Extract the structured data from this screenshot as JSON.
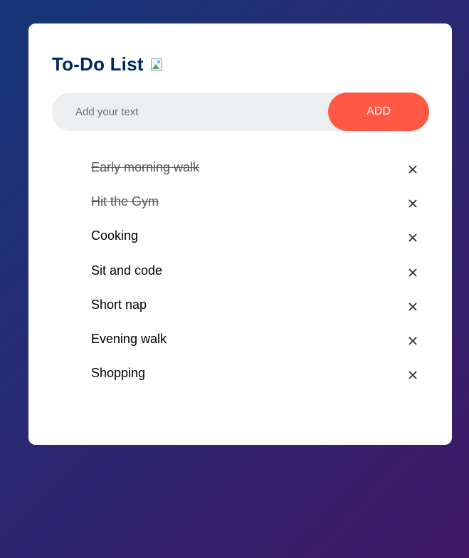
{
  "app": {
    "title": "To-Do List"
  },
  "input": {
    "placeholder": "Add your text",
    "value": ""
  },
  "add_button": {
    "label": "ADD"
  },
  "tasks": [
    {
      "label": "Early morning walk",
      "checked": true
    },
    {
      "label": "Hit the Gym",
      "checked": true
    },
    {
      "label": "Cooking",
      "checked": false
    },
    {
      "label": "Sit and code",
      "checked": false
    },
    {
      "label": "Short nap",
      "checked": false
    },
    {
      "label": "Evening walk",
      "checked": false
    },
    {
      "label": "Shopping",
      "checked": false
    }
  ],
  "icons": {
    "title_icon": "broken-image-icon",
    "remove_icon": "close-icon"
  },
  "colors": {
    "accent": "#ff5945",
    "title": "#002765",
    "card": "#ffffff",
    "input_bg": "#edeef0"
  }
}
